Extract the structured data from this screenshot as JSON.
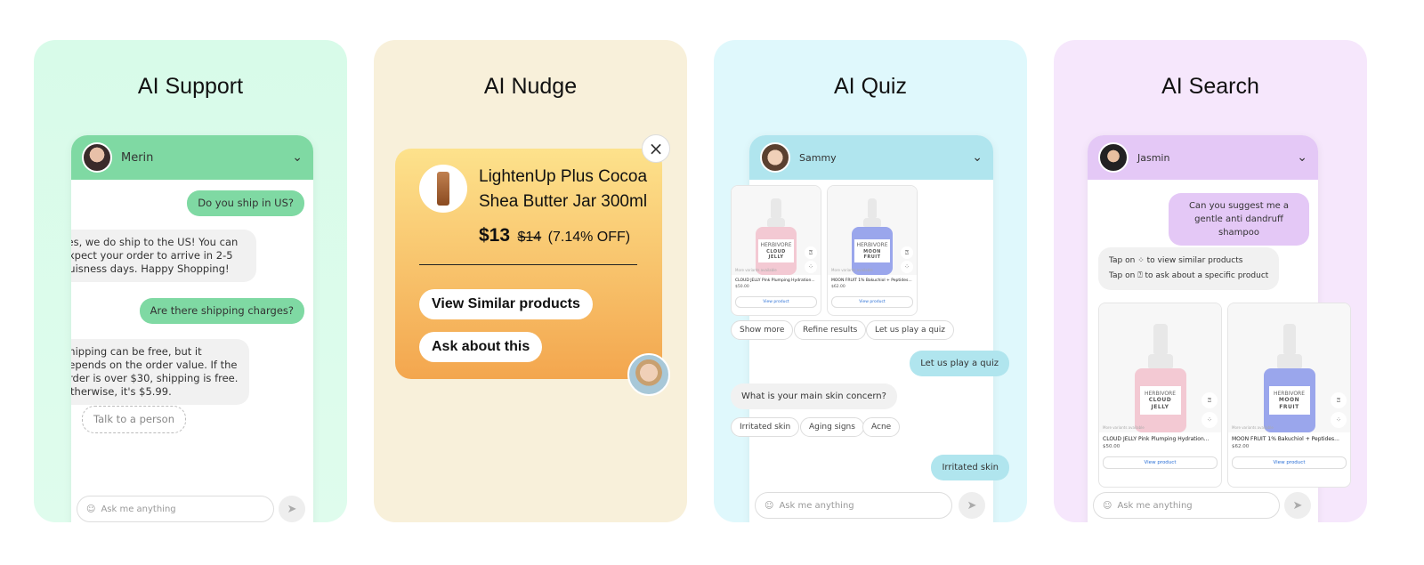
{
  "support": {
    "title": "AI Support",
    "agent": "Merin",
    "messages": [
      {
        "from": "user",
        "text": "Do you ship in US?"
      },
      {
        "from": "bot",
        "text": "Yes, we do ship to the US! You can expect your order to arrive in 2-5 buisness days. Happy Shopping!"
      },
      {
        "from": "user",
        "text": "Are there shipping charges?"
      },
      {
        "from": "bot",
        "text": "Shipping can be free, but it depends on the order value. If the order is over $30, shipping is free. Otherwise, it's $5.99."
      }
    ],
    "talk_label": "Talk to a person",
    "placeholder": "Ask me anything",
    "accent": "#7fd9a3"
  },
  "nudge": {
    "title": "AI Nudge",
    "product": "LightenUp Plus Cocoa Shea Butter Jar 300ml",
    "price": "$13",
    "old_price": "$14",
    "discount": "(7.14% OFF)",
    "btn_similar": "View Similar products",
    "btn_ask": "Ask about this",
    "close": "×"
  },
  "quiz": {
    "title": "AI Quiz",
    "agent": "Sammy",
    "products": [
      {
        "brand": "HERBIVORE",
        "name": "CLOUD JELLY Pink Plumping Hydration...",
        "label": "CLOUD JELLY",
        "price": "$50.00",
        "color": "#f3c9d3"
      },
      {
        "brand": "HERBIVORE",
        "name": "MOON FRUIT 1% Bakuchiol + Peptides...",
        "label": "MOON FRUIT",
        "price": "$62.00",
        "color": "#9aa6ec"
      }
    ],
    "view_product": "View product",
    "more_variants": "More variants available",
    "chips": [
      "Show more",
      "Refine results",
      "Let us play a quiz"
    ],
    "user_msg1": "Let us play a quiz",
    "question": "What is your main skin concern?",
    "options": [
      "Irritated skin",
      "Aging signs",
      "Acne"
    ],
    "user_msg2": "Irritated skin",
    "placeholder": "Ask me anything",
    "accent": "#b0e5ee"
  },
  "search": {
    "title": "AI Search",
    "agent": "Jasmin",
    "user_msg": "Can you suggest me a gentle anti dandruff shampoo",
    "tip1_a": "Tap on",
    "tip1_b": "to view similar products",
    "tip2_a": "Tap on",
    "tip2_b": "to ask about a specific product",
    "products": [
      {
        "brand": "HERBIVORE",
        "name": "CLOUD JELLY Pink Plumping Hydration...",
        "label": "CLOUD JELLY",
        "price": "$50.00"
      },
      {
        "brand": "HERBIVORE",
        "name": "MOON FRUIT 1% Bakuchiol + Peptides...",
        "label": "MOON FRUIT",
        "price": "$62.00"
      }
    ],
    "view_product": "View product",
    "more_variants": "More variants available",
    "placeholder": "Ask me anything",
    "accent": "#e4c8f6"
  }
}
